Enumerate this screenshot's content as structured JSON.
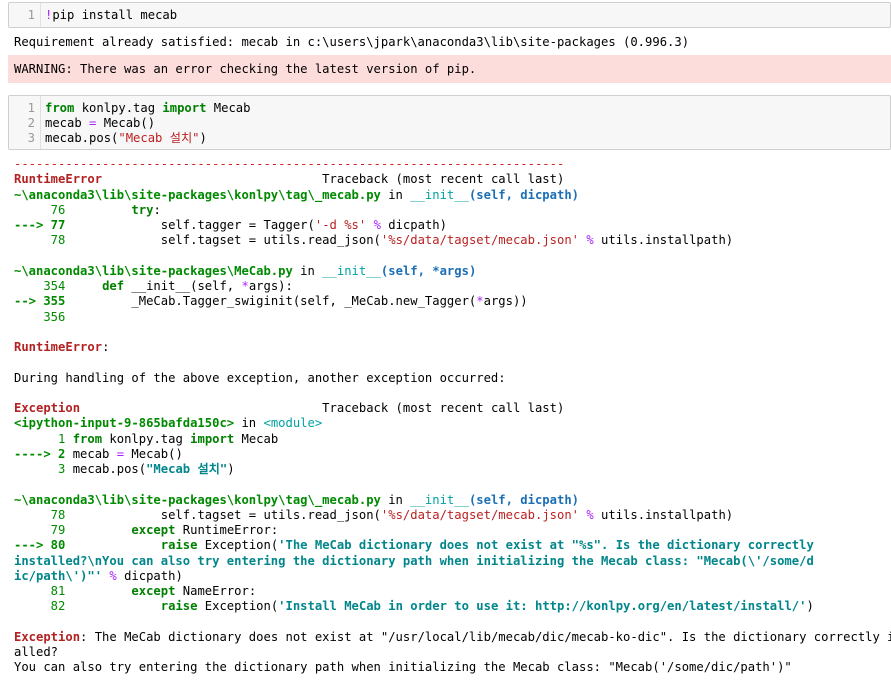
{
  "cells": [
    {
      "lines": [
        {
          "n": "1",
          "segments": [
            [
              "op",
              "!"
            ],
            [
              "",
              "pip install mecab"
            ]
          ]
        }
      ]
    },
    {
      "lines": [
        {
          "n": "1",
          "segments": [
            [
              "kw",
              "from"
            ],
            [
              "",
              " konlpy.tag "
            ],
            [
              "kw",
              "import"
            ],
            [
              "",
              " Mecab"
            ]
          ]
        },
        {
          "n": "2",
          "segments": [
            [
              "",
              "mecab "
            ],
            [
              "op",
              "="
            ],
            [
              "",
              " Mecab()"
            ]
          ]
        },
        {
          "n": "3",
          "segments": [
            [
              "",
              "mecab.pos("
            ],
            [
              "str",
              "\"Mecab 설치\""
            ],
            [
              "",
              ")"
            ]
          ]
        }
      ]
    }
  ],
  "output1": {
    "req": "Requirement already satisfied: mecab in c:\\users\\jpark\\anaconda3\\lib\\site-packages (0.996.3)",
    "warning": "WARNING: There was an error checking the latest version of pip."
  },
  "traceback": [
    [
      [
        "dashes",
        "---------------------------------------------------------------------------"
      ]
    ],
    [
      [
        "red",
        "RuntimeError"
      ],
      [
        "",
        "                              Traceback (most recent call last)"
      ]
    ],
    [
      [
        "green",
        "~\\anaconda3\\lib\\site-packages\\konlpy\\tag\\_mecab.py"
      ],
      [
        "",
        " in "
      ],
      [
        "cyan",
        "__init__"
      ],
      [
        "blue",
        "(self, dicpath)"
      ]
    ],
    [
      [
        "lnum",
        "     76"
      ],
      [
        "",
        "         "
      ],
      [
        "kw",
        "try"
      ],
      [
        "",
        ":"
      ]
    ],
    [
      [
        "green",
        "---> 77"
      ],
      [
        "",
        "             self.tagger = Tagger("
      ],
      [
        "str",
        "'-d %s'"
      ],
      [
        "",
        " "
      ],
      [
        "op",
        "%"
      ],
      [
        "",
        " dicpath)"
      ]
    ],
    [
      [
        "lnum",
        "     78"
      ],
      [
        "",
        "             self.tagset = utils.read_json("
      ],
      [
        "str",
        "'%s/data/tagset/mecab.json'"
      ],
      [
        "",
        " "
      ],
      [
        "op",
        "%"
      ],
      [
        "",
        " utils.installpath)"
      ]
    ],
    [
      [
        "",
        ""
      ]
    ],
    [
      [
        "green",
        "~\\anaconda3\\lib\\site-packages\\MeCab.py"
      ],
      [
        "",
        " in "
      ],
      [
        "cyan",
        "__init__"
      ],
      [
        "blue",
        "(self, *args)"
      ]
    ],
    [
      [
        "lnum",
        "    354"
      ],
      [
        "",
        "     "
      ],
      [
        "kw",
        "def"
      ],
      [
        "",
        " __init__(self, "
      ],
      [
        "op",
        "*"
      ],
      [
        "",
        "args):"
      ]
    ],
    [
      [
        "green",
        "--> 355"
      ],
      [
        "",
        "         _MeCab.Tagger_swiginit(self, _MeCab.new_Tagger("
      ],
      [
        "op",
        "*"
      ],
      [
        "",
        "args))"
      ]
    ],
    [
      [
        "lnum",
        "    356"
      ]
    ],
    [
      [
        "",
        ""
      ]
    ],
    [
      [
        "red",
        "RuntimeError"
      ],
      [
        "",
        ":"
      ]
    ],
    [
      [
        "",
        ""
      ]
    ],
    [
      [
        "",
        "During handling of the above exception, another exception occurred:"
      ]
    ],
    [
      [
        "",
        ""
      ]
    ],
    [
      [
        "red",
        "Exception"
      ],
      [
        "",
        "                                 Traceback (most recent call last)"
      ]
    ],
    [
      [
        "green",
        "<ipython-input-9-865bafda150c>"
      ],
      [
        "",
        " in "
      ],
      [
        "cyan",
        "<module>"
      ]
    ],
    [
      [
        "lnum",
        "      1"
      ],
      [
        "",
        " "
      ],
      [
        "kw",
        "from"
      ],
      [
        "",
        " konlpy.tag "
      ],
      [
        "kw",
        "import"
      ],
      [
        "",
        " Mecab"
      ]
    ],
    [
      [
        "green",
        "----> 2"
      ],
      [
        "",
        " mecab "
      ],
      [
        "op",
        "="
      ],
      [
        "",
        " Mecab()"
      ]
    ],
    [
      [
        "lnum",
        "      3"
      ],
      [
        "",
        " mecab.pos("
      ],
      [
        "teal",
        "\"Mecab 설치\""
      ],
      [
        "",
        ")"
      ]
    ],
    [
      [
        "",
        ""
      ]
    ],
    [
      [
        "green",
        "~\\anaconda3\\lib\\site-packages\\konlpy\\tag\\_mecab.py"
      ],
      [
        "",
        " in "
      ],
      [
        "cyan",
        "__init__"
      ],
      [
        "blue",
        "(self, dicpath)"
      ]
    ],
    [
      [
        "lnum",
        "     78"
      ],
      [
        "",
        "             self.tagset = utils.read_json("
      ],
      [
        "str",
        "'%s/data/tagset/mecab.json'"
      ],
      [
        "",
        " "
      ],
      [
        "op",
        "%"
      ],
      [
        "",
        " utils.installpath)"
      ]
    ],
    [
      [
        "lnum",
        "     79"
      ],
      [
        "",
        "         "
      ],
      [
        "kw",
        "except"
      ],
      [
        "",
        " RuntimeError:"
      ]
    ],
    [
      [
        "green",
        "---> 80"
      ],
      [
        "",
        "             "
      ],
      [
        "kw",
        "raise"
      ],
      [
        "",
        " Exception("
      ],
      [
        "teal",
        "'The MeCab dictionary does not exist at \"%s\". Is the dictionary correctly"
      ]
    ],
    [
      [
        "teal",
        "installed?\\nYou can also try entering the dictionary path when initializing the Mecab class: \"Mecab(\\'/some/d"
      ]
    ],
    [
      [
        "teal",
        "ic/path\\')\"'"
      ],
      [
        "",
        " "
      ],
      [
        "op",
        "%"
      ],
      [
        "",
        " dicpath)"
      ]
    ],
    [
      [
        "lnum",
        "     81"
      ],
      [
        "",
        "         "
      ],
      [
        "kw",
        "except"
      ],
      [
        "",
        " NameError:"
      ]
    ],
    [
      [
        "lnum",
        "     82"
      ],
      [
        "",
        "             "
      ],
      [
        "kw",
        "raise"
      ],
      [
        "",
        " Exception("
      ],
      [
        "teal",
        "'Install MeCab in order to use it: http://konlpy.org/en/latest/install/'"
      ],
      [
        "",
        ")"
      ]
    ],
    [
      [
        "",
        ""
      ]
    ],
    [
      [
        "red",
        "Exception"
      ],
      [
        "",
        ": The MeCab dictionary does not exist at \"/usr/local/lib/mecab/dic/mecab-ko-dic\". Is the dictionary correctly inst"
      ]
    ],
    [
      [
        "",
        "alled?"
      ]
    ],
    [
      [
        "",
        "You can also try entering the dictionary path when initializing the Mecab class: \"Mecab('/some/dic/path')\""
      ]
    ]
  ]
}
